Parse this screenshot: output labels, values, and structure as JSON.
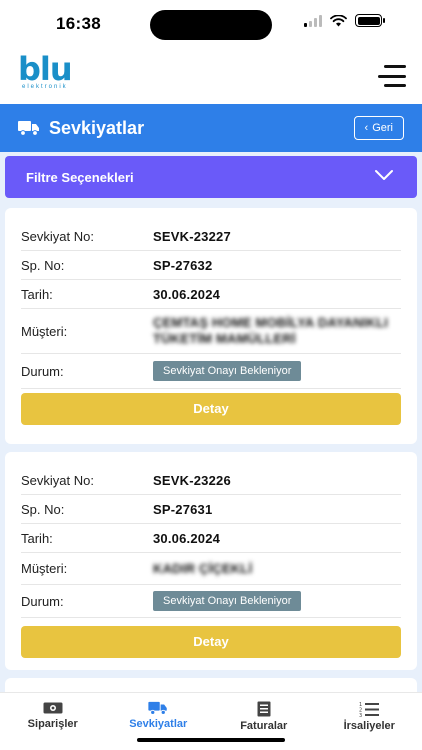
{
  "status_bar": {
    "time": "16:38"
  },
  "brand": {
    "logo_text": "blu",
    "logo_subtext": "elektronik"
  },
  "header": {
    "title": "Sevkiyatlar",
    "back_label": "Geri"
  },
  "filter": {
    "label": "Filtre Seçenekleri"
  },
  "field_labels": {
    "shipment_no": "Sevkiyat No:",
    "order_no": "Sp. No:",
    "date": "Tarih:",
    "customer": "Müşteri:",
    "status": "Durum:"
  },
  "shipments": [
    {
      "shipment_no": "SEVK-23227",
      "order_no": "SP-27632",
      "date": "30.06.2024",
      "customer": "ÇEMTAŞ HOME MOBİLYA DAYANIKLI TÜKETİM MAMÜLLERİ",
      "status": "Sevkiyat Onayı Bekleniyor",
      "detail_label": "Detay"
    },
    {
      "shipment_no": "SEVK-23226",
      "order_no": "SP-27631",
      "date": "30.06.2024",
      "customer": "KADIR ÇİÇEKLİ",
      "status": "Sevkiyat Onayı Bekleniyor",
      "detail_label": "Detay"
    }
  ],
  "tabs": [
    {
      "label": "Siparişler",
      "icon": "money-icon",
      "active": false
    },
    {
      "label": "Sevkiyatlar",
      "icon": "truck-icon",
      "active": true
    },
    {
      "label": "Faturalar",
      "icon": "invoice-icon",
      "active": false
    },
    {
      "label": "İrsaliyeler",
      "icon": "numbered-list-icon",
      "active": false
    }
  ],
  "colors": {
    "primary_blue": "#2e7fe8",
    "filter_purple": "#6a5af9",
    "detail_yellow": "#e8c440",
    "status_chip": "#6e8b97",
    "logo_blue": "#1a8fc8"
  }
}
